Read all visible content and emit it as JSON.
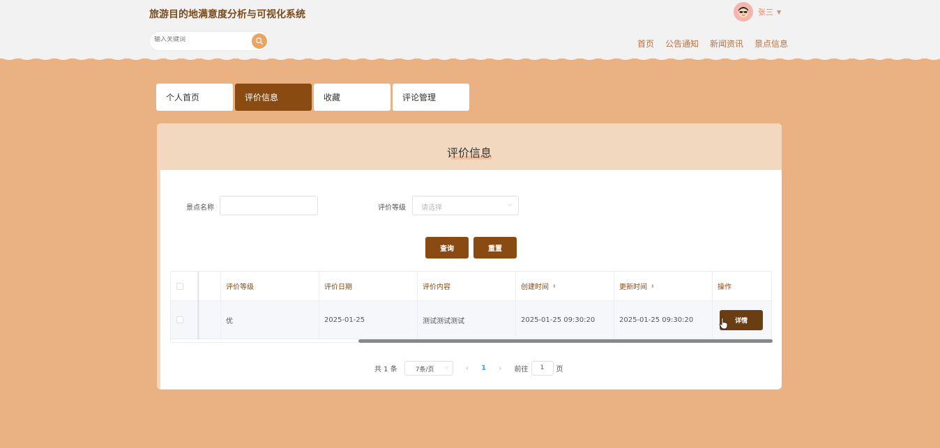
{
  "header": {
    "brand": "旅游目的地满意度分析与可视化系统",
    "search_placeholder": "输入关键词",
    "user_name": "张三",
    "nav": [
      "首页",
      "公告通知",
      "新闻资讯",
      "景点信息"
    ]
  },
  "tabs": [
    {
      "label": "个人首页",
      "active": false
    },
    {
      "label": "评价信息",
      "active": true
    },
    {
      "label": "收藏",
      "active": false
    },
    {
      "label": "评论管理",
      "active": false
    }
  ],
  "panel": {
    "title": "评价信息",
    "filters": {
      "name_label": "景点名称",
      "name_value": "",
      "level_label": "评价等级",
      "level_placeholder": "请选择"
    },
    "buttons": {
      "query": "查询",
      "reset": "重置"
    },
    "table": {
      "columns": [
        "评价等级",
        "评价日期",
        "评价内容",
        "创建时间",
        "更新时间",
        "操作"
      ],
      "rows": [
        {
          "level": "优",
          "date": "2025-01-25",
          "content": "测试测试测试",
          "created": "2025-01-25 09:30:20",
          "updated": "2025-01-25 09:30:20",
          "action": "详情"
        }
      ]
    },
    "pagination": {
      "total": "共 1 条",
      "page_size": "7条/页",
      "current_page": "1",
      "goto_label": "前往",
      "goto_value": "1",
      "page_suffix": "页"
    }
  },
  "colors": {
    "primary": "#8A4B12",
    "background": "#EAB282",
    "header_bg": "#F2F2F2"
  }
}
